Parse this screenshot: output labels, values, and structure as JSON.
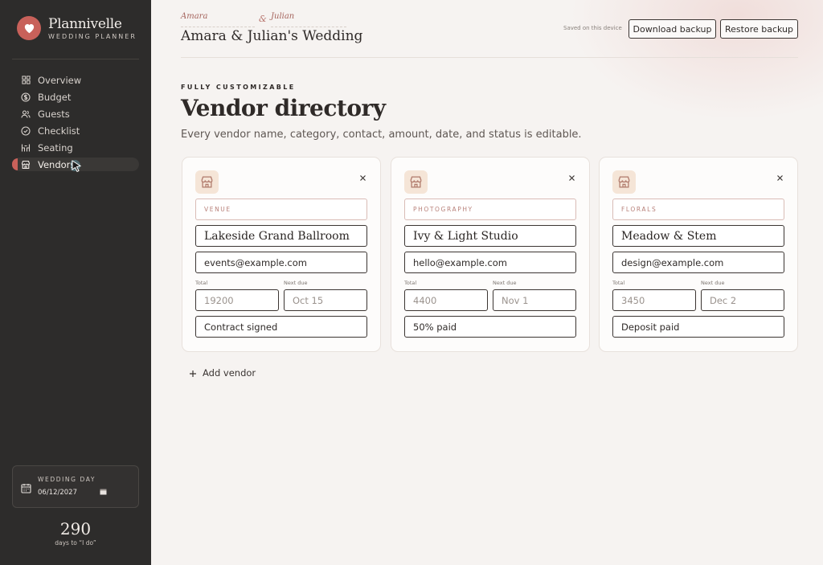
{
  "brand": {
    "name": "Plannivelle",
    "subtitle": "WEDDING PLANNER",
    "logo_icon": "heart-icon",
    "accent": "#c8615a"
  },
  "nav": {
    "items": [
      {
        "label": "Overview",
        "icon": "grid-icon",
        "active": false
      },
      {
        "label": "Budget",
        "icon": "dollar-icon",
        "active": false
      },
      {
        "label": "Guests",
        "icon": "people-icon",
        "active": false
      },
      {
        "label": "Checklist",
        "icon": "check-circle-icon",
        "active": false
      },
      {
        "label": "Seating",
        "icon": "chairs-icon",
        "active": false
      },
      {
        "label": "Vendors",
        "icon": "store-icon",
        "active": true
      }
    ]
  },
  "wedding_day": {
    "label": "WEDDING DAY",
    "value": "06/12/2027"
  },
  "countdown": {
    "days": "290",
    "caption": "days to “I do”"
  },
  "header": {
    "partner_a": "Amara",
    "ampersand": "&",
    "partner_b": "Julian",
    "wedding_title": "Amara & Julian's Wedding",
    "saved_note": "Saved on this device",
    "download_label": "Download backup",
    "restore_label": "Restore backup"
  },
  "page": {
    "eyebrow": "FULLY CUSTOMIZABLE",
    "title": "Vendor directory",
    "subtitle": "Every vendor name, category, contact, amount, date, and status is editable."
  },
  "labels": {
    "total": "Total",
    "next_due": "Next due"
  },
  "vendors": [
    {
      "category": "VENUE",
      "name": "Lakeside Grand Ballroom",
      "contact": "events@example.com",
      "total": "19200",
      "next_due": "Oct 15",
      "status": "Contract signed"
    },
    {
      "category": "PHOTOGRAPHY",
      "name": "Ivy & Light Studio",
      "contact": "hello@example.com",
      "total": "4400",
      "next_due": "Nov 1",
      "status": "50% paid"
    },
    {
      "category": "FLORALS",
      "name": "Meadow & Stem",
      "contact": "design@example.com",
      "total": "3450",
      "next_due": "Dec 2",
      "status": "Deposit paid"
    }
  ],
  "add_vendor_label": "Add vendor"
}
